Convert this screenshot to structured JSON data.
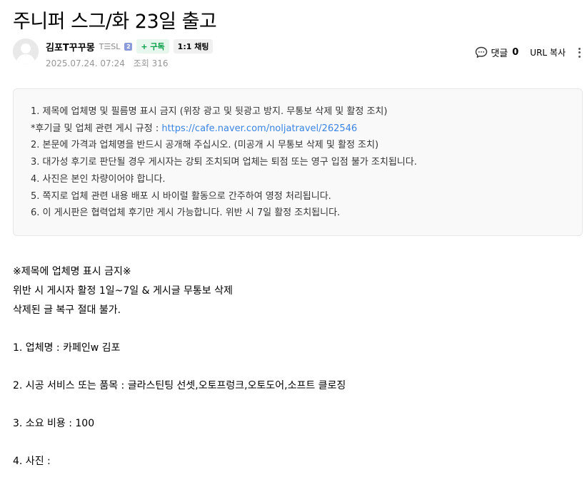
{
  "post": {
    "title": "주니퍼 스그/화 23일 출고",
    "author": {
      "nickname": "김포T꾸꾸몽",
      "grade_label": "T☰SL",
      "grade_badge": "2",
      "follow_label": "+ 구독",
      "chat_label": "1:1 채팅"
    },
    "date": "2025.07.24. 07:24",
    "views": "조회 316",
    "comment_label": "댓글",
    "comment_count": "0",
    "url_copy_label": "URL 복사"
  },
  "notice": {
    "line1": "1. 제목에 업체명 및 필름명 표시 금지 (위장 광고 및 뒷광고 방지. 무통보 삭제 및 활정 조치)",
    "line2_prefix": "*후기글 및 업체 관련 게시 규정 : ",
    "line2_link": "https://cafe.naver.com/noljatravel/262546",
    "line3": "2. 본문에 가격과 업체명을 반드시 공개해 주십시오. (미공개 시 무통보 삭제 및 활정 조치)",
    "line4": "3. 대가성 후기로 판단될 경우 게시자는 강퇴 조치되며 업체는 퇴점 또는 영구 입점 불가 조치됩니다.",
    "line5": "4. 사진은 본인 차량이어야 합니다.",
    "line6": "5. 쪽지로 업체 관련 내용 배포 시 바이럴 활동으로 간주하여 영정 처리됩니다.",
    "line7": "6. 이 게시판은 협력업체 후기만 게시 가능합니다. 위반 시 7일 활정 조치됩니다."
  },
  "body": {
    "warning1": "※제목에 업체명 표시 금지※",
    "warning2": "위반 시 게시자 활정 1일~7일 & 게시글 무통보 삭제",
    "warning3": "삭제된 글 복구 절대 불가.",
    "item1": "1. 업체명 : 카페인w 김포",
    "item2": "2. 시공 서비스 또는 품목 : 글라스틴팅 선셋,오토프렁크,오토도어,소프트 클로징",
    "item3": "3. 소요 비용 : 100",
    "item4": "4. 사진 :"
  },
  "icons": {
    "avatar": "default-avatar",
    "comment": "speech-bubble-icon",
    "more": "vertical-ellipsis-icon"
  },
  "colors": {
    "follow_green": "#009f47",
    "link_blue": "#3b85e3"
  }
}
